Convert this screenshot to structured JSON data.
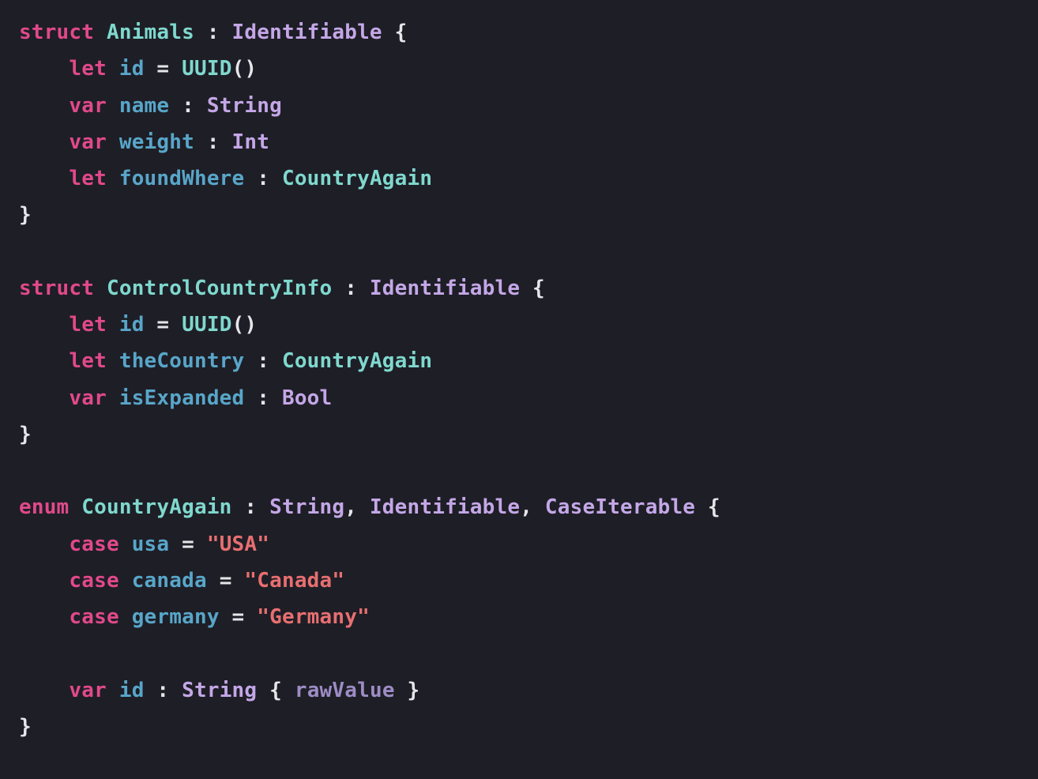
{
  "lines": {
    "l1": {
      "kw1": "struct",
      "type": "Animals",
      "colon": ":",
      "prot": "Identifiable",
      "brace": "{"
    },
    "l2": {
      "kw": "let",
      "id": "id",
      "eq": "=",
      "type": "UUID",
      "par": "()"
    },
    "l3": {
      "kw": "var",
      "id": "name",
      "colon": ":",
      "type": "String"
    },
    "l4": {
      "kw": "var",
      "id": "weight",
      "colon": ":",
      "type": "Int"
    },
    "l5": {
      "kw": "let",
      "id": "foundWhere",
      "colon": ":",
      "type": "CountryAgain"
    },
    "l6": {
      "brace": "}"
    },
    "l7": {
      "empty": ""
    },
    "l8": {
      "kw1": "struct",
      "type": "ControlCountryInfo",
      "colon": ":",
      "prot": "Identifiable",
      "brace": "{"
    },
    "l9": {
      "kw": "let",
      "id": "id",
      "eq": "=",
      "type": "UUID",
      "par": "()"
    },
    "l10": {
      "kw": "let",
      "id": "theCountry",
      "colon": ":",
      "type": "CountryAgain"
    },
    "l11": {
      "kw": "var",
      "id": "isExpanded",
      "colon": ":",
      "type": "Bool"
    },
    "l12": {
      "brace": "}"
    },
    "l13": {
      "empty": ""
    },
    "l14": {
      "kw1": "enum",
      "type": "CountryAgain",
      "colon": ":",
      "p1": "String",
      "c1": ",",
      "p2": "Identifiable",
      "c2": ",",
      "p3": "CaseIterable",
      "brace": "{"
    },
    "l15": {
      "kw": "case",
      "id": "usa",
      "eq": "=",
      "str": "\"USA\""
    },
    "l16": {
      "kw": "case",
      "id": "canada",
      "eq": "=",
      "str": "\"Canada\""
    },
    "l17": {
      "kw": "case",
      "id": "germany",
      "eq": "=",
      "str": "\"Germany\""
    },
    "l18": {
      "empty": ""
    },
    "l19": {
      "kw": "var",
      "id": "id",
      "colon": ":",
      "type": "String",
      "b1": "{",
      "mem": "rawValue",
      "b2": "}"
    },
    "l20": {
      "brace": "}"
    }
  },
  "colors": {
    "background": "#1e1e26",
    "keyword": "#e1498a",
    "type": "#7fd8ce",
    "protocol": "#c4a7e7",
    "identifier": "#58a6c9",
    "punctuation": "#e6e6ea",
    "string": "#e76f70",
    "member": "#9d8cc4"
  }
}
